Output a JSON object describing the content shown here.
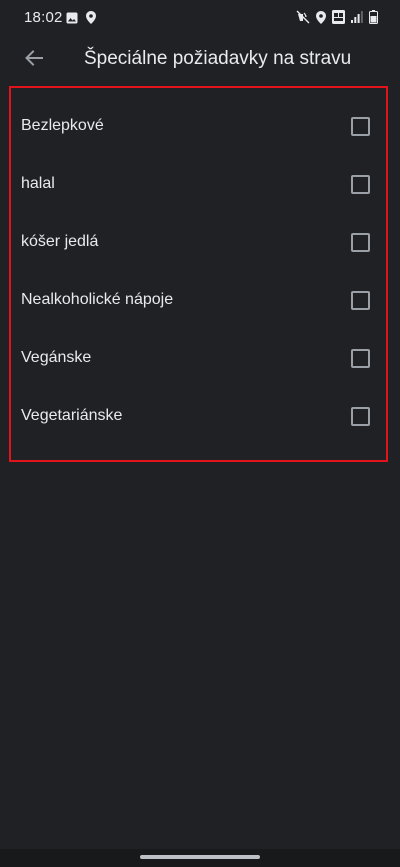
{
  "status_bar": {
    "time": "18:02"
  },
  "header": {
    "title": "Špeciálne požiadavky na stravu"
  },
  "options": [
    {
      "label": "Bezlepkové",
      "checked": false
    },
    {
      "label": "halal",
      "checked": false
    },
    {
      "label": "kóšer jedlá",
      "checked": false
    },
    {
      "label": "Nealkoholické nápoje",
      "checked": false
    },
    {
      "label": "Vegánske",
      "checked": false
    },
    {
      "label": "Vegetariánske",
      "checked": false
    }
  ],
  "colors": {
    "background": "#202124",
    "highlight_border": "#e1141b",
    "text": "#e8eaed",
    "checkbox_border": "#9aa0a6"
  }
}
